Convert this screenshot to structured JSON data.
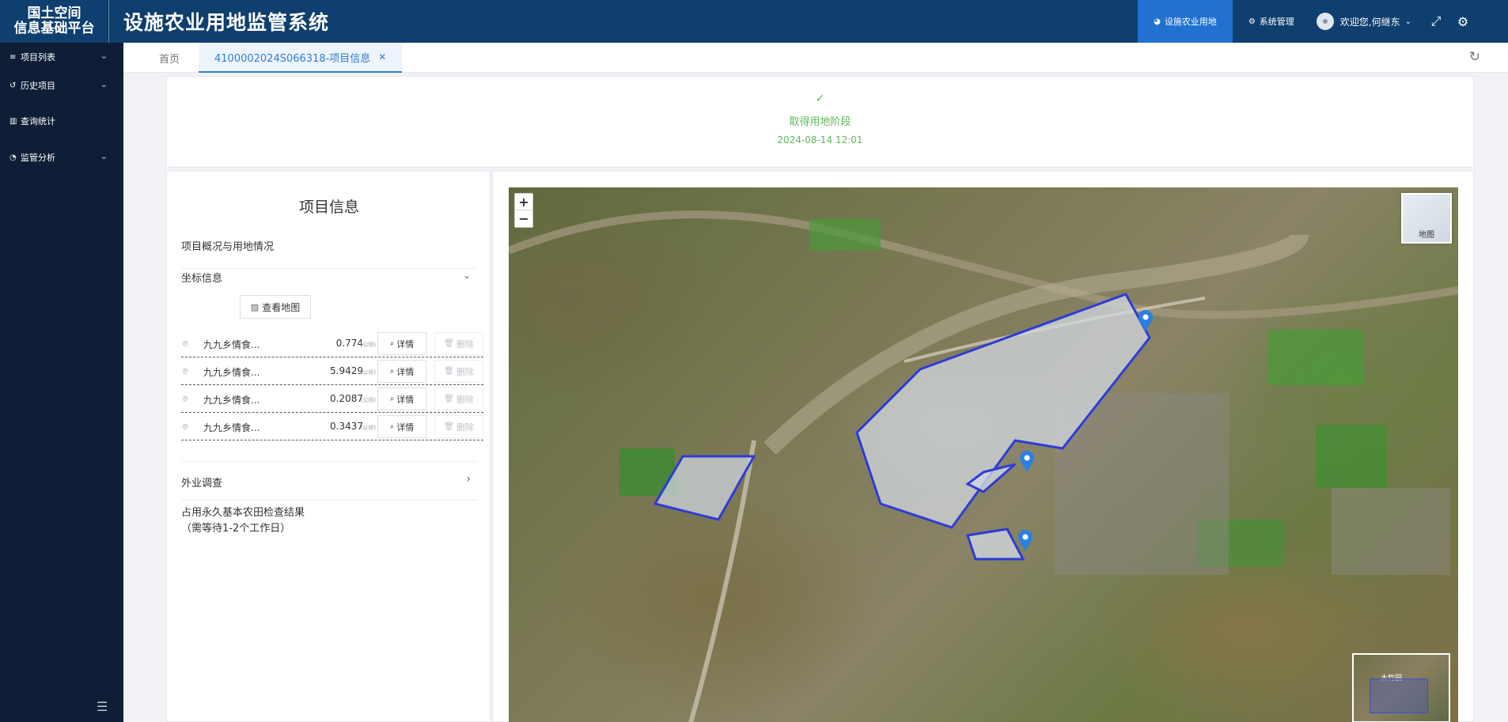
{
  "header": {
    "logo_line1": "国土空间",
    "logo_line2": "信息基础平台",
    "system_title": "设施农业用地监管系统",
    "nav": [
      {
        "label": "设施农业用地",
        "active": true,
        "icon": "pie-icon"
      },
      {
        "label": "系统管理",
        "active": false,
        "icon": "gears-icon"
      }
    ],
    "user_greeting": "欢迎您,何继东"
  },
  "sidebar": {
    "items": [
      {
        "label": "项目列表",
        "icon": "list-icon",
        "expandable": true
      },
      {
        "label": "历史项目",
        "icon": "history-icon",
        "expandable": true
      },
      {
        "label": "查询统计",
        "icon": "bar-chart-icon",
        "expandable": false
      },
      {
        "label": "监管分析",
        "icon": "pie-chart-icon",
        "expandable": true
      }
    ]
  },
  "tabs": {
    "home": "首页",
    "active": "4100002024S066318-项目信息"
  },
  "stage": {
    "name": "取得用地阶段",
    "time": "2024-08-14 12:01",
    "color": "#5cb85c"
  },
  "info": {
    "title": "项目信息",
    "overview_label": "项目概况与用地情况",
    "coords_label": "坐标信息",
    "view_map_label": "查看地图",
    "detail_label": "详情",
    "delete_label": "删除",
    "unit_label": "(公顷)",
    "coordinates": [
      {
        "name": "九九乡情食...",
        "area": "0.774"
      },
      {
        "name": "九九乡情食...",
        "area": "5.9429"
      },
      {
        "name": "九九乡情食...",
        "area": "0.2087"
      },
      {
        "name": "九九乡情食...",
        "area": "0.3437"
      }
    ],
    "field_survey_label": "外业调查",
    "result_line1": "占用永久基本农田检查结果",
    "result_line2": "（需等待1-2个工作日）"
  },
  "map": {
    "zoom_in": "+",
    "zoom_out": "−",
    "layer_label": "地图",
    "overview_label": "大竹园",
    "accent": "#2d3cd8"
  }
}
